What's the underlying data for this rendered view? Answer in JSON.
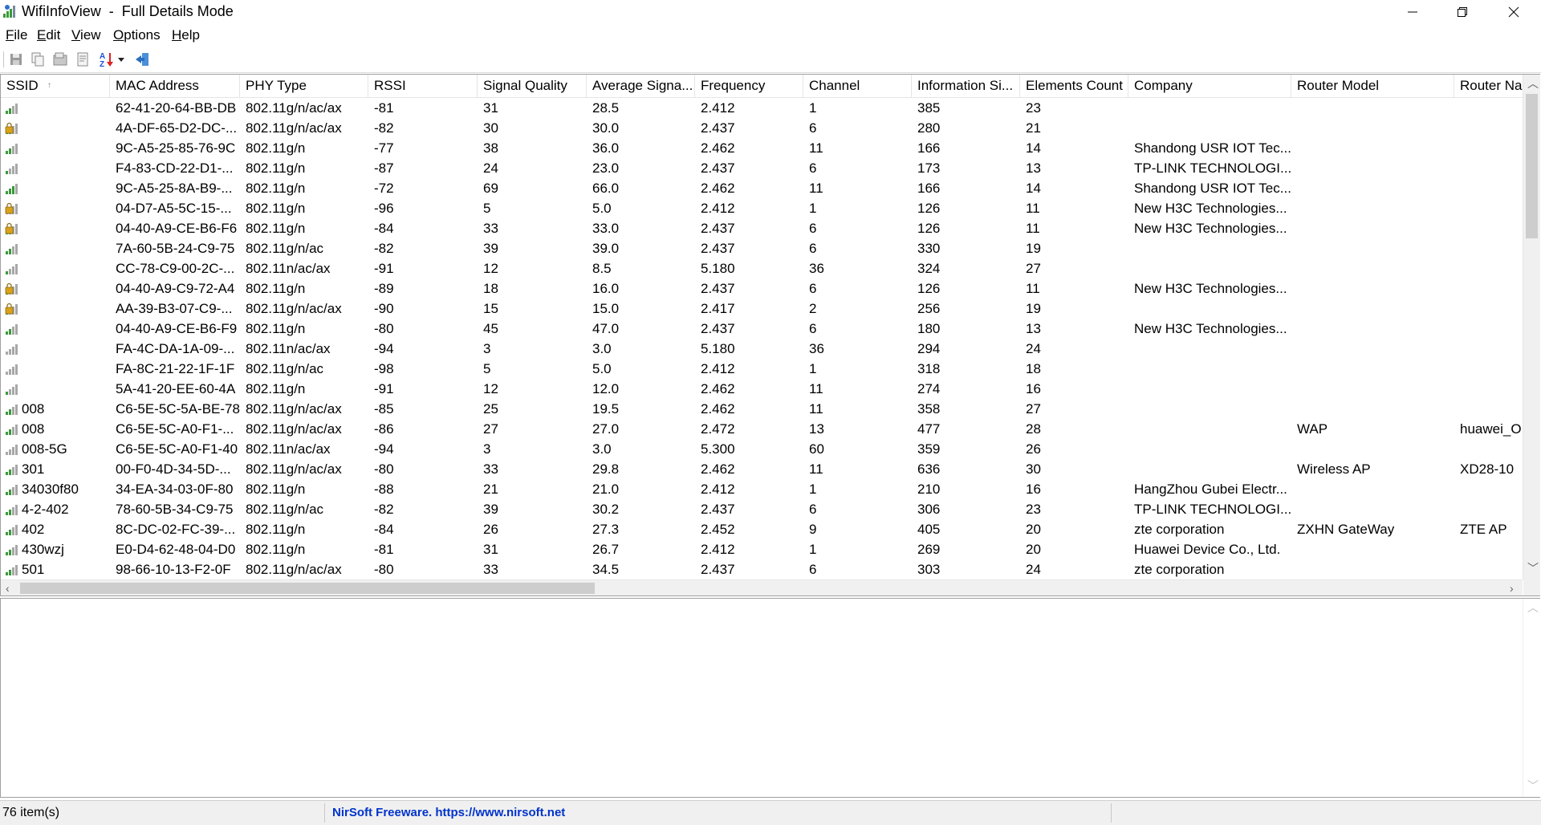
{
  "window": {
    "title": "WifiInfoView  -  Full Details Mode",
    "controls": [
      "minimize",
      "maximize",
      "close"
    ]
  },
  "menu": {
    "items": [
      {
        "label": "File",
        "mnemonic": "F",
        "rest": "ile"
      },
      {
        "label": "Edit",
        "mnemonic": "E",
        "rest": "dit"
      },
      {
        "label": "View",
        "mnemonic": "V",
        "rest": "iew"
      },
      {
        "label": "Options",
        "mnemonic": "O",
        "rest": "ptions"
      },
      {
        "label": "Help",
        "mnemonic": "H",
        "rest": "elp"
      }
    ]
  },
  "toolbar": {
    "buttons": [
      {
        "name": "save-icon",
        "tooltip": "Save Selected Items"
      },
      {
        "name": "copy-icon",
        "tooltip": "Copy Selected Items"
      },
      {
        "name": "html-report-icon",
        "tooltip": "HTML Report"
      },
      {
        "name": "properties-icon",
        "tooltip": "Properties"
      },
      {
        "name": "sort-az-icon",
        "tooltip": "Sort"
      },
      {
        "name": "exit-icon",
        "tooltip": "Exit"
      }
    ]
  },
  "table": {
    "columns": [
      "SSID",
      "MAC Address",
      "PHY Type",
      "RSSI",
      "Signal Quality",
      "Average Signa...",
      "Frequency",
      "Channel",
      "Information Si...",
      "Elements Count",
      "Company",
      "Router Model",
      "Router Na"
    ],
    "sort_indicator": "↑",
    "rows": [
      {
        "signal": 2,
        "secured": false,
        "ssid": "",
        "mac": "62-41-20-64-BB-DB",
        "phy": "802.11g/n/ac/ax",
        "rssi": "-81",
        "quality": "31",
        "avg": "28.5",
        "freq": "2.412",
        "channel": "1",
        "info": "385",
        "elements": "23",
        "company": "",
        "model": "",
        "router": ""
      },
      {
        "signal": 2,
        "secured": true,
        "ssid": "",
        "mac": "4A-DF-65-D2-DC-...",
        "phy": "802.11g/n/ac/ax",
        "rssi": "-82",
        "quality": "30",
        "avg": "30.0",
        "freq": "2.437",
        "channel": "6",
        "info": "280",
        "elements": "21",
        "company": "",
        "model": "",
        "router": ""
      },
      {
        "signal": 2,
        "secured": false,
        "ssid": "",
        "mac": "9C-A5-25-85-76-9C",
        "phy": "802.11g/n",
        "rssi": "-77",
        "quality": "38",
        "avg": "36.0",
        "freq": "2.462",
        "channel": "11",
        "info": "166",
        "elements": "14",
        "company": "Shandong USR IOT Tec...",
        "model": "",
        "router": ""
      },
      {
        "signal": 1,
        "secured": false,
        "ssid": "",
        "mac": "F4-83-CD-22-D1-...",
        "phy": "802.11g/n",
        "rssi": "-87",
        "quality": "24",
        "avg": "23.0",
        "freq": "2.437",
        "channel": "6",
        "info": "173",
        "elements": "13",
        "company": "TP-LINK TECHNOLOGI...",
        "model": "",
        "router": ""
      },
      {
        "signal": 3,
        "secured": false,
        "ssid": "",
        "mac": "9C-A5-25-8A-B9-...",
        "phy": "802.11g/n",
        "rssi": "-72",
        "quality": "69",
        "avg": "66.0",
        "freq": "2.462",
        "channel": "11",
        "info": "166",
        "elements": "14",
        "company": "Shandong USR IOT Tec...",
        "model": "",
        "router": ""
      },
      {
        "signal": 0,
        "secured": true,
        "ssid": "",
        "mac": "04-D7-A5-5C-15-...",
        "phy": "802.11g/n",
        "rssi": "-96",
        "quality": "5",
        "avg": "5.0",
        "freq": "2.412",
        "channel": "1",
        "info": "126",
        "elements": "11",
        "company": "New H3C Technologies...",
        "model": "",
        "router": ""
      },
      {
        "signal": 2,
        "secured": true,
        "ssid": "",
        "mac": "04-40-A9-CE-B6-F6",
        "phy": "802.11g/n",
        "rssi": "-84",
        "quality": "33",
        "avg": "33.0",
        "freq": "2.437",
        "channel": "6",
        "info": "126",
        "elements": "11",
        "company": "New H3C Technologies...",
        "model": "",
        "router": ""
      },
      {
        "signal": 2,
        "secured": false,
        "ssid": "",
        "mac": "7A-60-5B-24-C9-75",
        "phy": "802.11g/n/ac",
        "rssi": "-82",
        "quality": "39",
        "avg": "39.0",
        "freq": "2.437",
        "channel": "6",
        "info": "330",
        "elements": "19",
        "company": "",
        "model": "",
        "router": ""
      },
      {
        "signal": 1,
        "secured": false,
        "ssid": "",
        "mac": "CC-78-C9-00-2C-...",
        "phy": "802.11n/ac/ax",
        "rssi": "-91",
        "quality": "12",
        "avg": "8.5",
        "freq": "5.180",
        "channel": "36",
        "info": "324",
        "elements": "27",
        "company": "",
        "model": "",
        "router": ""
      },
      {
        "signal": 1,
        "secured": true,
        "ssid": "",
        "mac": "04-40-A9-C9-72-A4",
        "phy": "802.11g/n",
        "rssi": "-89",
        "quality": "18",
        "avg": "16.0",
        "freq": "2.437",
        "channel": "6",
        "info": "126",
        "elements": "11",
        "company": "New H3C Technologies...",
        "model": "",
        "router": ""
      },
      {
        "signal": 1,
        "secured": true,
        "ssid": "",
        "mac": "AA-39-B3-07-C9-...",
        "phy": "802.11g/n/ac/ax",
        "rssi": "-90",
        "quality": "15",
        "avg": "15.0",
        "freq": "2.417",
        "channel": "2",
        "info": "256",
        "elements": "19",
        "company": "",
        "model": "",
        "router": ""
      },
      {
        "signal": 2,
        "secured": false,
        "ssid": "",
        "mac": "04-40-A9-CE-B6-F9",
        "phy": "802.11g/n",
        "rssi": "-80",
        "quality": "45",
        "avg": "47.0",
        "freq": "2.437",
        "channel": "6",
        "info": "180",
        "elements": "13",
        "company": "New H3C Technologies...",
        "model": "",
        "router": ""
      },
      {
        "signal": 0,
        "secured": false,
        "ssid": "",
        "mac": "FA-4C-DA-1A-09-...",
        "phy": "802.11n/ac/ax",
        "rssi": "-94",
        "quality": "3",
        "avg": "3.0",
        "freq": "5.180",
        "channel": "36",
        "info": "294",
        "elements": "24",
        "company": "",
        "model": "",
        "router": ""
      },
      {
        "signal": 0,
        "secured": false,
        "ssid": "",
        "mac": "FA-8C-21-22-1F-1F",
        "phy": "802.11g/n/ac",
        "rssi": "-98",
        "quality": "5",
        "avg": "5.0",
        "freq": "2.412",
        "channel": "1",
        "info": "318",
        "elements": "18",
        "company": "",
        "model": "",
        "router": ""
      },
      {
        "signal": 1,
        "secured": false,
        "ssid": "",
        "mac": "5A-41-20-EE-60-4A",
        "phy": "802.11g/n",
        "rssi": "-91",
        "quality": "12",
        "avg": "12.0",
        "freq": "2.462",
        "channel": "11",
        "info": "274",
        "elements": "16",
        "company": "",
        "model": "",
        "router": ""
      },
      {
        "signal": 2,
        "secured": false,
        "ssid": "008",
        "mac": "C6-5E-5C-5A-BE-78",
        "phy": "802.11g/n/ac/ax",
        "rssi": "-85",
        "quality": "25",
        "avg": "19.5",
        "freq": "2.462",
        "channel": "11",
        "info": "358",
        "elements": "27",
        "company": "",
        "model": "",
        "router": ""
      },
      {
        "signal": 2,
        "secured": false,
        "ssid": "008",
        "mac": "C6-5E-5C-A0-F1-...",
        "phy": "802.11g/n/ac/ax",
        "rssi": "-86",
        "quality": "27",
        "avg": "27.0",
        "freq": "2.472",
        "channel": "13",
        "info": "477",
        "elements": "28",
        "company": "",
        "model": "WAP",
        "router": "huawei_OI"
      },
      {
        "signal": 0,
        "secured": false,
        "ssid": "008-5G",
        "mac": "C6-5E-5C-A0-F1-40",
        "phy": "802.11n/ac/ax",
        "rssi": "-94",
        "quality": "3",
        "avg": "3.0",
        "freq": "5.300",
        "channel": "60",
        "info": "359",
        "elements": "26",
        "company": "",
        "model": "",
        "router": ""
      },
      {
        "signal": 2,
        "secured": false,
        "ssid": "301",
        "mac": "00-F0-4D-34-5D-...",
        "phy": "802.11g/n/ac/ax",
        "rssi": "-80",
        "quality": "33",
        "avg": "29.8",
        "freq": "2.462",
        "channel": "11",
        "info": "636",
        "elements": "30",
        "company": "",
        "model": "Wireless AP",
        "router": "XD28-10"
      },
      {
        "signal": 2,
        "secured": false,
        "ssid": "34030f80",
        "mac": "34-EA-34-03-0F-80",
        "phy": "802.11g/n",
        "rssi": "-88",
        "quality": "21",
        "avg": "21.0",
        "freq": "2.412",
        "channel": "1",
        "info": "210",
        "elements": "16",
        "company": "HangZhou Gubei Electr...",
        "model": "",
        "router": ""
      },
      {
        "signal": 2,
        "secured": false,
        "ssid": "4-2-402",
        "mac": "78-60-5B-34-C9-75",
        "phy": "802.11g/n/ac",
        "rssi": "-82",
        "quality": "39",
        "avg": "30.2",
        "freq": "2.437",
        "channel": "6",
        "info": "306",
        "elements": "23",
        "company": "TP-LINK TECHNOLOGI...",
        "model": "",
        "router": ""
      },
      {
        "signal": 2,
        "secured": false,
        "ssid": "402",
        "mac": "8C-DC-02-FC-39-...",
        "phy": "802.11g/n",
        "rssi": "-84",
        "quality": "26",
        "avg": "27.3",
        "freq": "2.452",
        "channel": "9",
        "info": "405",
        "elements": "20",
        "company": "zte corporation",
        "model": "ZXHN GateWay",
        "router": "ZTE AP"
      },
      {
        "signal": 2,
        "secured": false,
        "ssid": "430wzj",
        "mac": "E0-D4-62-48-04-D0",
        "phy": "802.11g/n",
        "rssi": "-81",
        "quality": "31",
        "avg": "26.7",
        "freq": "2.412",
        "channel": "1",
        "info": "269",
        "elements": "20",
        "company": "Huawei Device Co., Ltd.",
        "model": "",
        "router": ""
      },
      {
        "signal": 2,
        "secured": false,
        "ssid": "501",
        "mac": "98-66-10-13-F2-0F",
        "phy": "802.11g/n/ac/ax",
        "rssi": "-80",
        "quality": "33",
        "avg": "34.5",
        "freq": "2.437",
        "channel": "6",
        "info": "303",
        "elements": "24",
        "company": "zte corporation",
        "model": "",
        "router": ""
      }
    ]
  },
  "status": {
    "item_count": "76 item(s)",
    "link": "NirSoft Freeware. https://www.nirsoft.net"
  },
  "colors": {
    "signal_bar_on": "#3a9a3a",
    "signal_bar_off": "#a8a8a8",
    "lock": "#d9a21b",
    "link": "#0033cc"
  }
}
